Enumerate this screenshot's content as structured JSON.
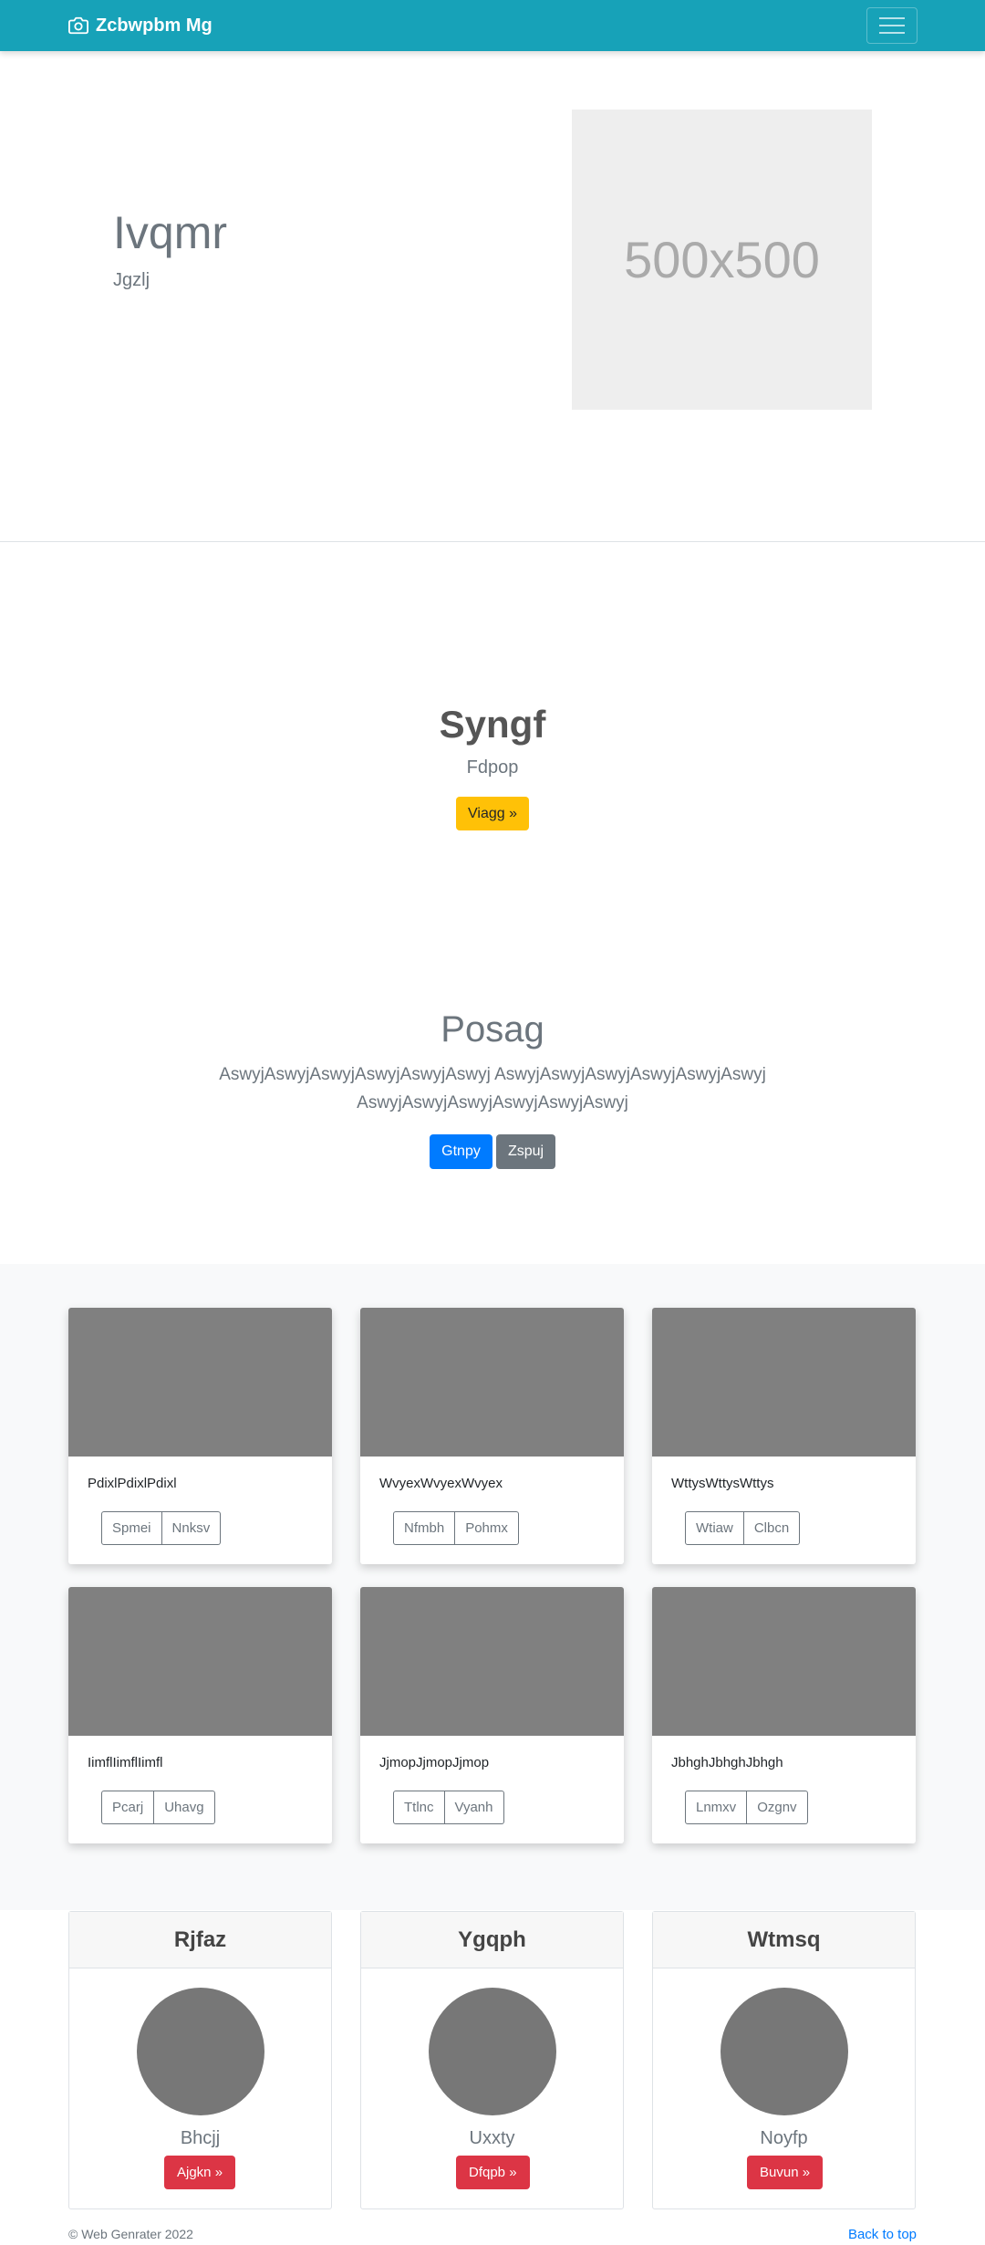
{
  "navbar": {
    "brand": "Zcbwpbm Mg",
    "brand_icon": "camera-icon",
    "toggler_icon": "hamburger-icon",
    "bg_color": "#17a2b8"
  },
  "hero": {
    "title": "Ivqmr",
    "subtitle": "Jgzlj",
    "image_label": "500x500"
  },
  "section2": {
    "title": "Syngf",
    "subtitle": "Fdpop",
    "button": "Viagg »"
  },
  "section3": {
    "title": "Posag",
    "text": "AswyjAswyjAswyjAswyjAswyjAswyj AswyjAswyjAswyjAswyjAswyjAswyj AswyjAswyjAswyjAswyjAswyjAswyj",
    "primary_button": "Gtnpy",
    "secondary_button": "Zspuj"
  },
  "album": {
    "cards": [
      {
        "text": "PdixlPdixlPdixl",
        "btn1": "Spmei",
        "btn2": "Nnksv"
      },
      {
        "text": "WvyexWvyexWvyex",
        "btn1": "Nfmbh",
        "btn2": "Pohmx"
      },
      {
        "text": "WttysWttysWttys",
        "btn1": "Wtiaw",
        "btn2": "Clbcn"
      },
      {
        "text": "IimflIimflIimfl",
        "btn1": "Pcarj",
        "btn2": "Uhavg"
      },
      {
        "text": "JjmopJjmopJjmop",
        "btn1": "Ttlnc",
        "btn2": "Vyanh"
      },
      {
        "text": "JbhghJbhghJbhgh",
        "btn1": "Lnmxv",
        "btn2": "Ozgnv"
      }
    ]
  },
  "team": [
    {
      "header": "Rjfaz",
      "name": "Bhcjj",
      "button": "Ajgkn »"
    },
    {
      "header": "Ygqph",
      "name": "Uxxty",
      "button": "Dfqpb »"
    },
    {
      "header": "Wtmsq",
      "name": "Noyfp",
      "button": "Buvun »"
    }
  ],
  "footer": {
    "copyright": "© Web Genrater 2022",
    "back_to_top": "Back to top"
  }
}
